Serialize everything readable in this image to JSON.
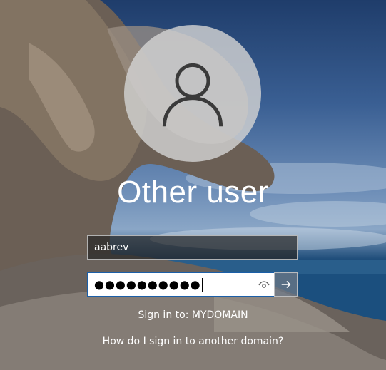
{
  "user": {
    "display_name": "Other user",
    "avatar_icon": "user-silhouette-icon"
  },
  "login": {
    "username_value": "aabrev",
    "password_masked": "●●●●●●●●●●",
    "reveal_icon": "eye-icon",
    "submit_icon": "arrow-right-icon"
  },
  "domain": {
    "sign_in_to": "Sign in to: MYDOMAIN",
    "help_link": "How do I sign in to another domain?"
  },
  "colors": {
    "focus_border": "#1b5fa8",
    "text": "#ffffff"
  }
}
